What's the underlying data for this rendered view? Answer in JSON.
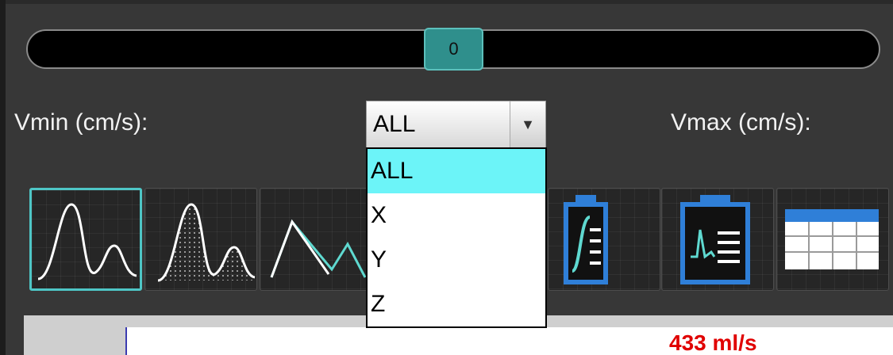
{
  "slider": {
    "value": "0",
    "accent": "#2f8f8c"
  },
  "labels": {
    "vmin": "Vmin (cm/s):",
    "vmax": "Vmax (cm/s):"
  },
  "axis_select": {
    "value": "ALL",
    "options": [
      "ALL",
      "X",
      "Y",
      "Z"
    ],
    "highlight_color": "#6cf4f8"
  },
  "toolbar": {
    "buttons": [
      {
        "icon": "curve-outline-icon",
        "active": true
      },
      {
        "icon": "curve-filled-icon",
        "active": false
      },
      {
        "icon": "linear-curve-icon",
        "active": false
      },
      {
        "icon": "report-integral-icon",
        "active": false
      },
      {
        "icon": "report-waveform-icon",
        "active": false
      },
      {
        "icon": "table-icon",
        "active": false
      }
    ]
  },
  "plot": {
    "partial_value": "433 ml/s"
  }
}
